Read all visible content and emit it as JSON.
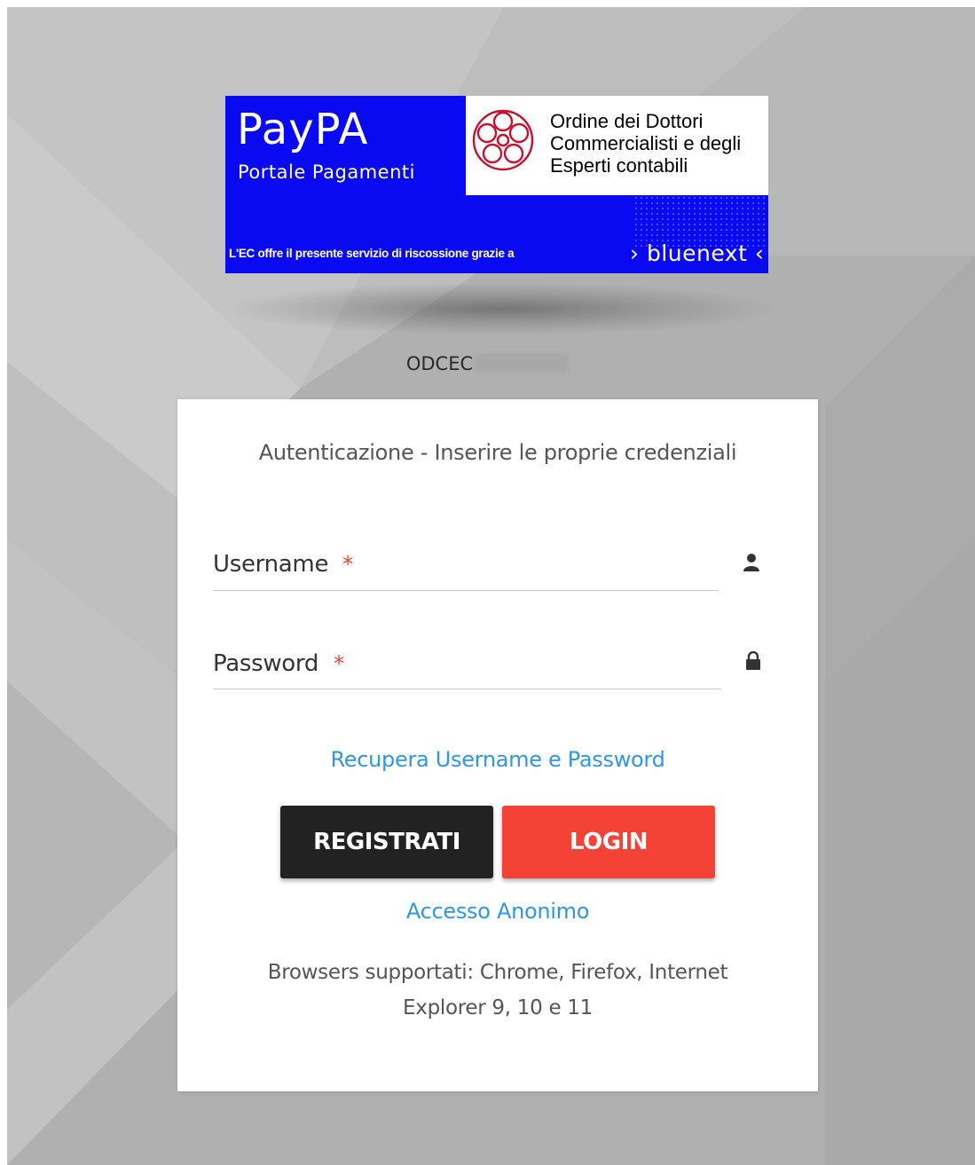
{
  "banner": {
    "brand": "PayPA",
    "subtitle": "Portale Pagamenti",
    "org_line1": "Ordine dei Dottori",
    "org_line2": "Commercialisti e degli",
    "org_line3": "Esperti contabili",
    "footer": "L'EC offre il presente servizio di riscossione grazie a",
    "partner": "› bluenext ‹",
    "colors": {
      "blue": "#0a0af2",
      "logo_red": "#c8102e"
    }
  },
  "entity": {
    "name": "ODCEC"
  },
  "card": {
    "title": "Autenticazione - Inserire le proprie credenziali",
    "username": {
      "placeholder": "Username",
      "value": "",
      "required_mark": "*",
      "icon": "user-icon"
    },
    "password": {
      "placeholder": "Password",
      "value": "",
      "required_mark": "*",
      "icon": "lock-icon"
    },
    "recover_link": "Recupera Username e Password",
    "register_button": "REGISTRATI",
    "login_button": "LOGIN",
    "anonymous_link": "Accesso Anonimo",
    "browsers_line1": "Browsers supportati: Chrome, Firefox, Internet",
    "browsers_line2": "Explorer 9, 10 e 11",
    "colors": {
      "accent": "#f44336",
      "link": "#2f97e9",
      "dark_button": "#222222"
    }
  }
}
